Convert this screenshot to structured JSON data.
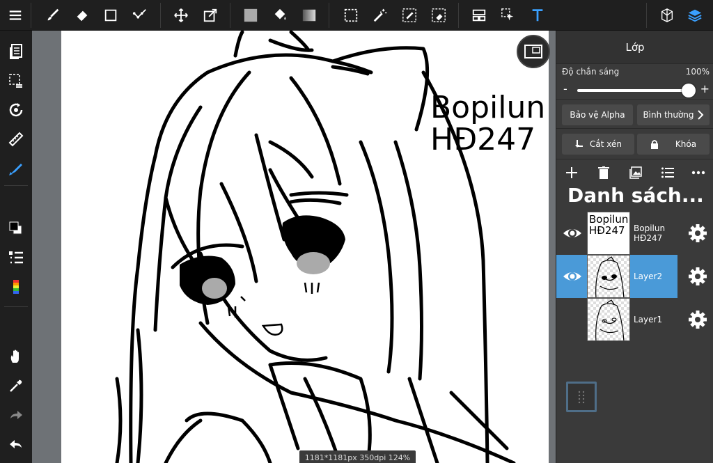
{
  "canvas": {
    "stamp_text": "Bopilun\nHĐ247",
    "status": "1181*1181px 350dpi 124%"
  },
  "panel": {
    "title": "Lớp",
    "opacity_label": "Độ chắn sáng",
    "opacity_value": "100%",
    "opacity_level": 1.0,
    "minus": "-",
    "plus": "+",
    "protect_alpha": "Bảo vệ Alpha",
    "blend_mode": "Bình thường",
    "clipping": "Cắt xén",
    "lock": "Khóa",
    "list_title": "Danh sách...",
    "layers": [
      {
        "name": "Bopilun\nHĐ247",
        "thumb_text": "Bopilun\nHĐ247",
        "visible": true,
        "active": false
      },
      {
        "name": "Layer2",
        "visible": true,
        "active": true
      },
      {
        "name": "Layer1",
        "visible": false,
        "active": false
      }
    ]
  },
  "colors": {
    "accent": "#4a9ad8",
    "toolbar_bg": "#1f1f1f",
    "panel_bg": "#3a3a3a",
    "text_tool_blue": "#3aa0ff"
  },
  "icons": {
    "top": [
      "menu-icon",
      "brush-icon",
      "eraser-icon",
      "rectangle-icon",
      "smudge-icon",
      "move-icon",
      "transform-icon",
      "fill-color-icon",
      "bucket-icon",
      "gradient-icon",
      "select-rect-icon",
      "magic-wand-icon",
      "select-pen-icon",
      "select-eraser-icon",
      "layout-icon",
      "select-cursor-icon",
      "text-icon",
      "3d-icon",
      "layers-icon"
    ],
    "left": [
      "pages-icon",
      "selection-icon",
      "rotate-icon",
      "ruler-icon",
      "snap-icon",
      "color-swatch-icon",
      "layer-list-icon",
      "color-palette-icon",
      "hand-icon",
      "eyedropper-icon",
      "redo-icon",
      "undo-icon"
    ]
  }
}
